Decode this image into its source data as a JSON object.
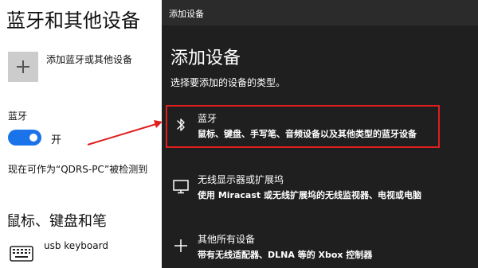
{
  "settings": {
    "page_title": "蓝牙和其他设备",
    "add_device_label": "添加蓝牙或其他设备",
    "bluetooth_label": "蓝牙",
    "bluetooth_state": "开",
    "discoverable_text": "现在可作为“QDRS-PC”被检测到",
    "section_mouse_keyboard": "鼠标、键盘和笔",
    "device_name": "usb keyboard",
    "toggle_color": "#1a73e8"
  },
  "dialog": {
    "window_title": "添加设备",
    "heading": "添加设备",
    "subtitle": "选择要添加的设备的类型。",
    "options": [
      {
        "icon": "bluetooth-icon",
        "title": "蓝牙",
        "desc": "鼠标、键盘、手写笔、音频设备以及其他类型的蓝牙设备",
        "selected": true
      },
      {
        "icon": "monitor-icon",
        "title": "无线显示器或扩展坞",
        "desc": "使用 Miracast 或无线扩展坞的无线监视器、电视或电脑",
        "selected": false
      },
      {
        "icon": "plus-icon",
        "title": "其他所有设备",
        "desc": "带有无线适配器、DLNA 等的 Xbox 控制器",
        "selected": false
      }
    ]
  },
  "colors": {
    "dialog_bg": "#1f1f1f",
    "highlight": "#e01e1e",
    "annotation_arrow": "#e01e1e"
  }
}
